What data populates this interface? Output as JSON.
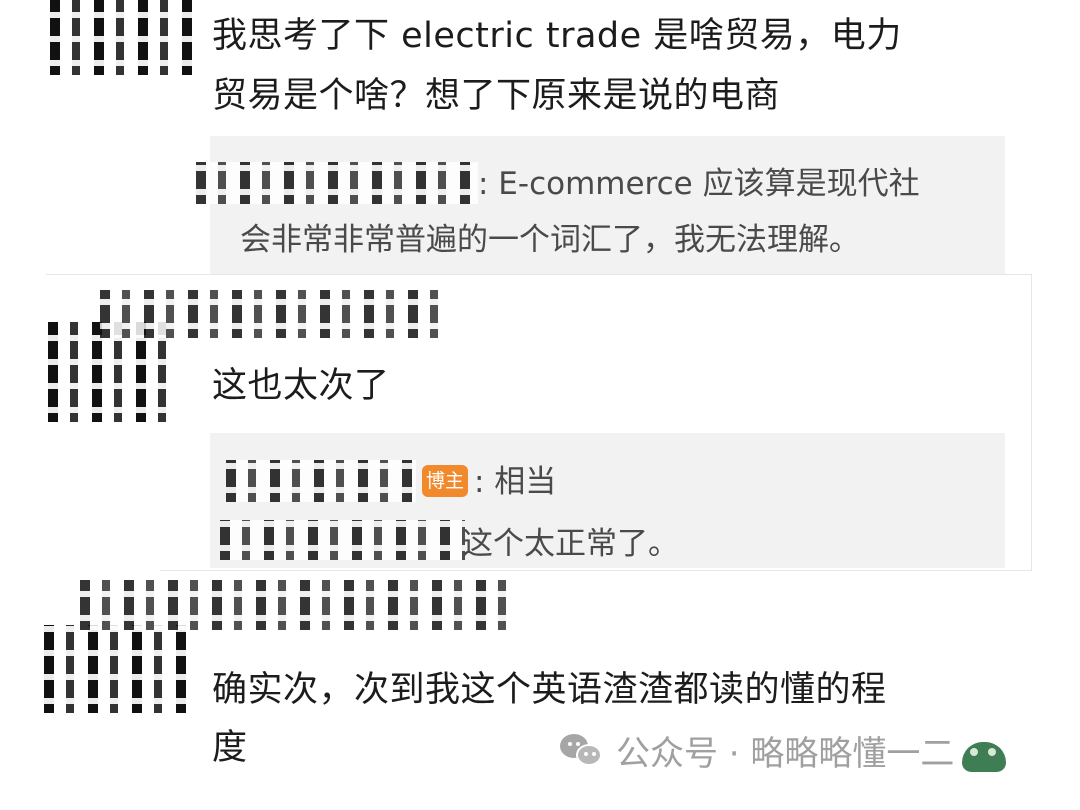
{
  "comments": [
    {
      "text": "我思考了下 electric trade 是啥贸易，电力贸易是个啥？想了下原来是说的电商",
      "line1": "我思考了下 electric trade 是啥贸易，电力",
      "line2": "贸易是个啥？想了下原来是说的电商",
      "reply": {
        "line1": ": E-commerce 应该算是现代社",
        "line2": "会非常非常普遍的一个词汇了，我无法理解。"
      }
    },
    {
      "text": "这也太次了",
      "reply": {
        "badge": "博主",
        "line1": ": 相当",
        "line2": "这个太正常了。"
      }
    },
    {
      "line1": "确实次，次到我这个英语渣渣都读的懂的程",
      "line2": "度"
    }
  ],
  "watermark": {
    "text": "公众号 · 略略略懂一二"
  },
  "colors": {
    "badge": "#f08a2c",
    "quote_bg": "#f2f2f2",
    "text": "#1c1c1c",
    "watermark": "#a0a0a0"
  },
  "icons": [
    "wechat-icon",
    "frog-sticker-icon"
  ]
}
